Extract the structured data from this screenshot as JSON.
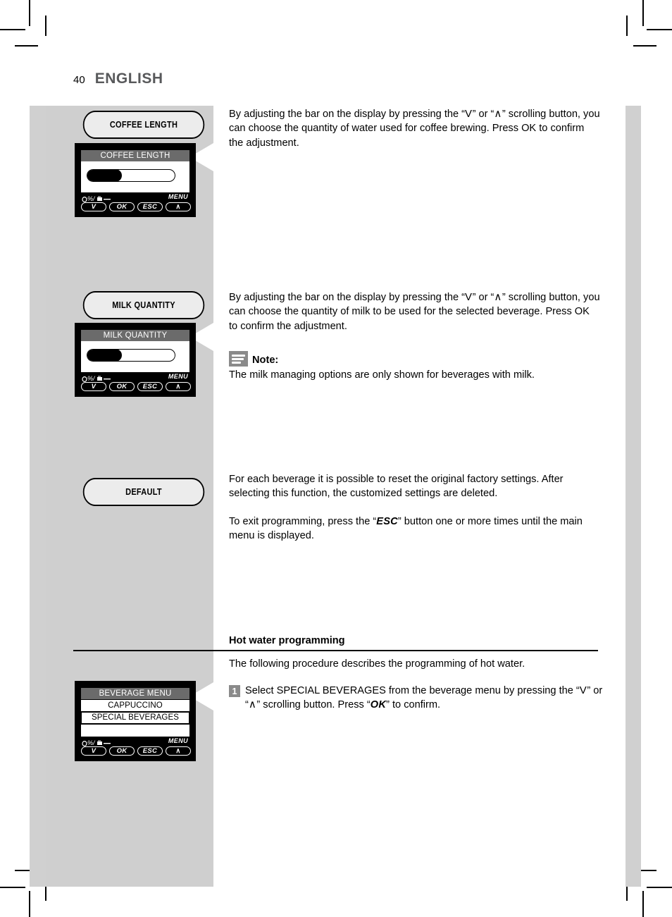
{
  "page": {
    "number": "40",
    "language": "ENGLISH"
  },
  "sections": [
    {
      "pill_label": "COFFEE LENGTH",
      "display": {
        "title": "COFFEE LENGTH",
        "type": "bar",
        "bar_fill_percent": 40,
        "keys": [
          "V",
          "OK",
          "ESC",
          "∧"
        ],
        "menu_label": "MENU"
      },
      "paragraph": "By adjusting the bar on the display  by pressing the “V” or “∧” scrolling button, you can choose the quantity of water used for coffee brewing. Press OK to confirm the adjustment."
    },
    {
      "pill_label": "MILK QUANTITY",
      "display": {
        "title": "MILK QUANTITY",
        "type": "bar",
        "bar_fill_percent": 40,
        "keys": [
          "V",
          "OK",
          "ESC",
          "∧"
        ],
        "menu_label": "MENU"
      },
      "paragraph": "By adjusting the bar on the display by pressing the “V” or “∧” scrolling button, you can choose the quantity of milk to be used for the selected beverage. Press OK to confirm the adjustment.",
      "note": {
        "title": "Note:",
        "body": "The milk managing options are only shown for beverages with milk."
      }
    },
    {
      "pill_label": "DEFAULT",
      "paragraph": "For each beverage it is possible to reset the original factory settings. After selecting this function, the customized settings are deleted.",
      "paragraph2": "To exit programming, press the “ESC” button one or more times until the main menu is displayed."
    }
  ],
  "hot_water": {
    "heading": "Hot water programming",
    "intro": "The following procedure describes the programming of hot water.",
    "step_number": "1",
    "step_text": "Select SPECIAL BEVERAGES from the beverage menu by pressing the “V” or “∧” scrolling button. Press “OK” to confirm.",
    "display": {
      "title": "BEVERAGE MENU",
      "type": "list",
      "rows": [
        "CAPPUCCINO",
        "SPECIAL BEVERAGES",
        ""
      ],
      "selected_row": "SPECIAL BEVERAGES",
      "keys": [
        "V",
        "OK",
        "ESC",
        "∧"
      ],
      "menu_label": "MENU"
    }
  },
  "text_fragments": {
    "p1_a": "By adjusting the bar on the display  by pressing the “",
    "p1_sym1": "V",
    "p1_b": "” or “",
    "p1_sym2": "∧",
    "p1_c": "” scrolling button, you can choose the quantity of water used for coffee brewing. Press OK to confirm the adjustment.",
    "p2_a": "By adjusting the bar on the display by pressing the “",
    "p2_c": "” scrolling button, you can choose the quantity of milk to be used for the selected beverage. Press OK to confirm the adjustment.",
    "p3_a": "To exit programming, press the “",
    "p3_esc": "ESC",
    "p3_b": "” button one or more times until the main menu is displayed.",
    "s1_a": "Select SPECIAL BEVERAGES from the beverage menu by pressing the “",
    "s1_b": "” or “",
    "s1_c": "” scrolling button. Press “",
    "s1_ok": "OK",
    "s1_d": "” to confirm."
  },
  "colors": {
    "gray_panel": "#cfcfcf",
    "display_header": "#6b6b6b",
    "badge_gray": "#8a8a8a",
    "heading_gray": "#58595b"
  }
}
